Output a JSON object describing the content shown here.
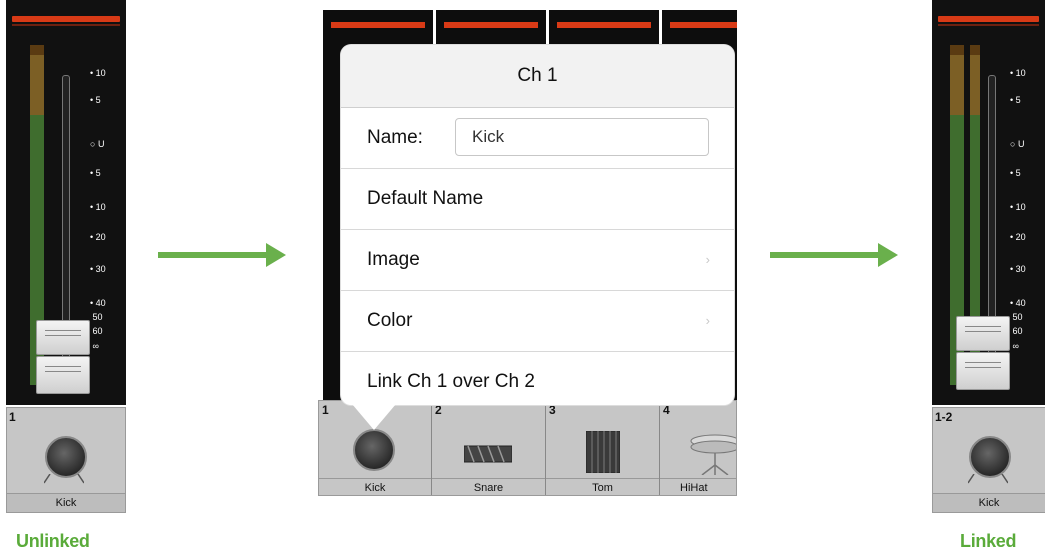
{
  "left_channel": {
    "number": "1",
    "name": "Kick",
    "scale": [
      "10",
      "5",
      "U",
      "5",
      "10",
      "20",
      "30",
      "40",
      "50",
      "60",
      "∞"
    ]
  },
  "right_channel": {
    "number": "1-2",
    "name": "Kick",
    "scale": [
      "10",
      "5",
      "U",
      "5",
      "10",
      "20",
      "30",
      "40",
      "50",
      "60",
      "∞"
    ]
  },
  "captions": {
    "left": "Unlinked",
    "right": "Linked"
  },
  "popup": {
    "title": "Ch 1",
    "name_label": "Name:",
    "name_value": "Kick",
    "rows": [
      "Default Name",
      "Image",
      "Color",
      "Link Ch 1 over Ch 2"
    ]
  },
  "bottom_channels": [
    {
      "number": "1",
      "name": "Kick",
      "icon": "kick-drum-icon"
    },
    {
      "number": "2",
      "name": "Snare",
      "icon": "snare-drum-icon"
    },
    {
      "number": "3",
      "name": "Tom",
      "icon": "tom-drum-icon"
    },
    {
      "number": "4",
      "name": "HiHat",
      "icon": "hihat-icon"
    }
  ],
  "colors": {
    "accent_green": "#6ab04c",
    "meter_red": "#d83a16"
  }
}
